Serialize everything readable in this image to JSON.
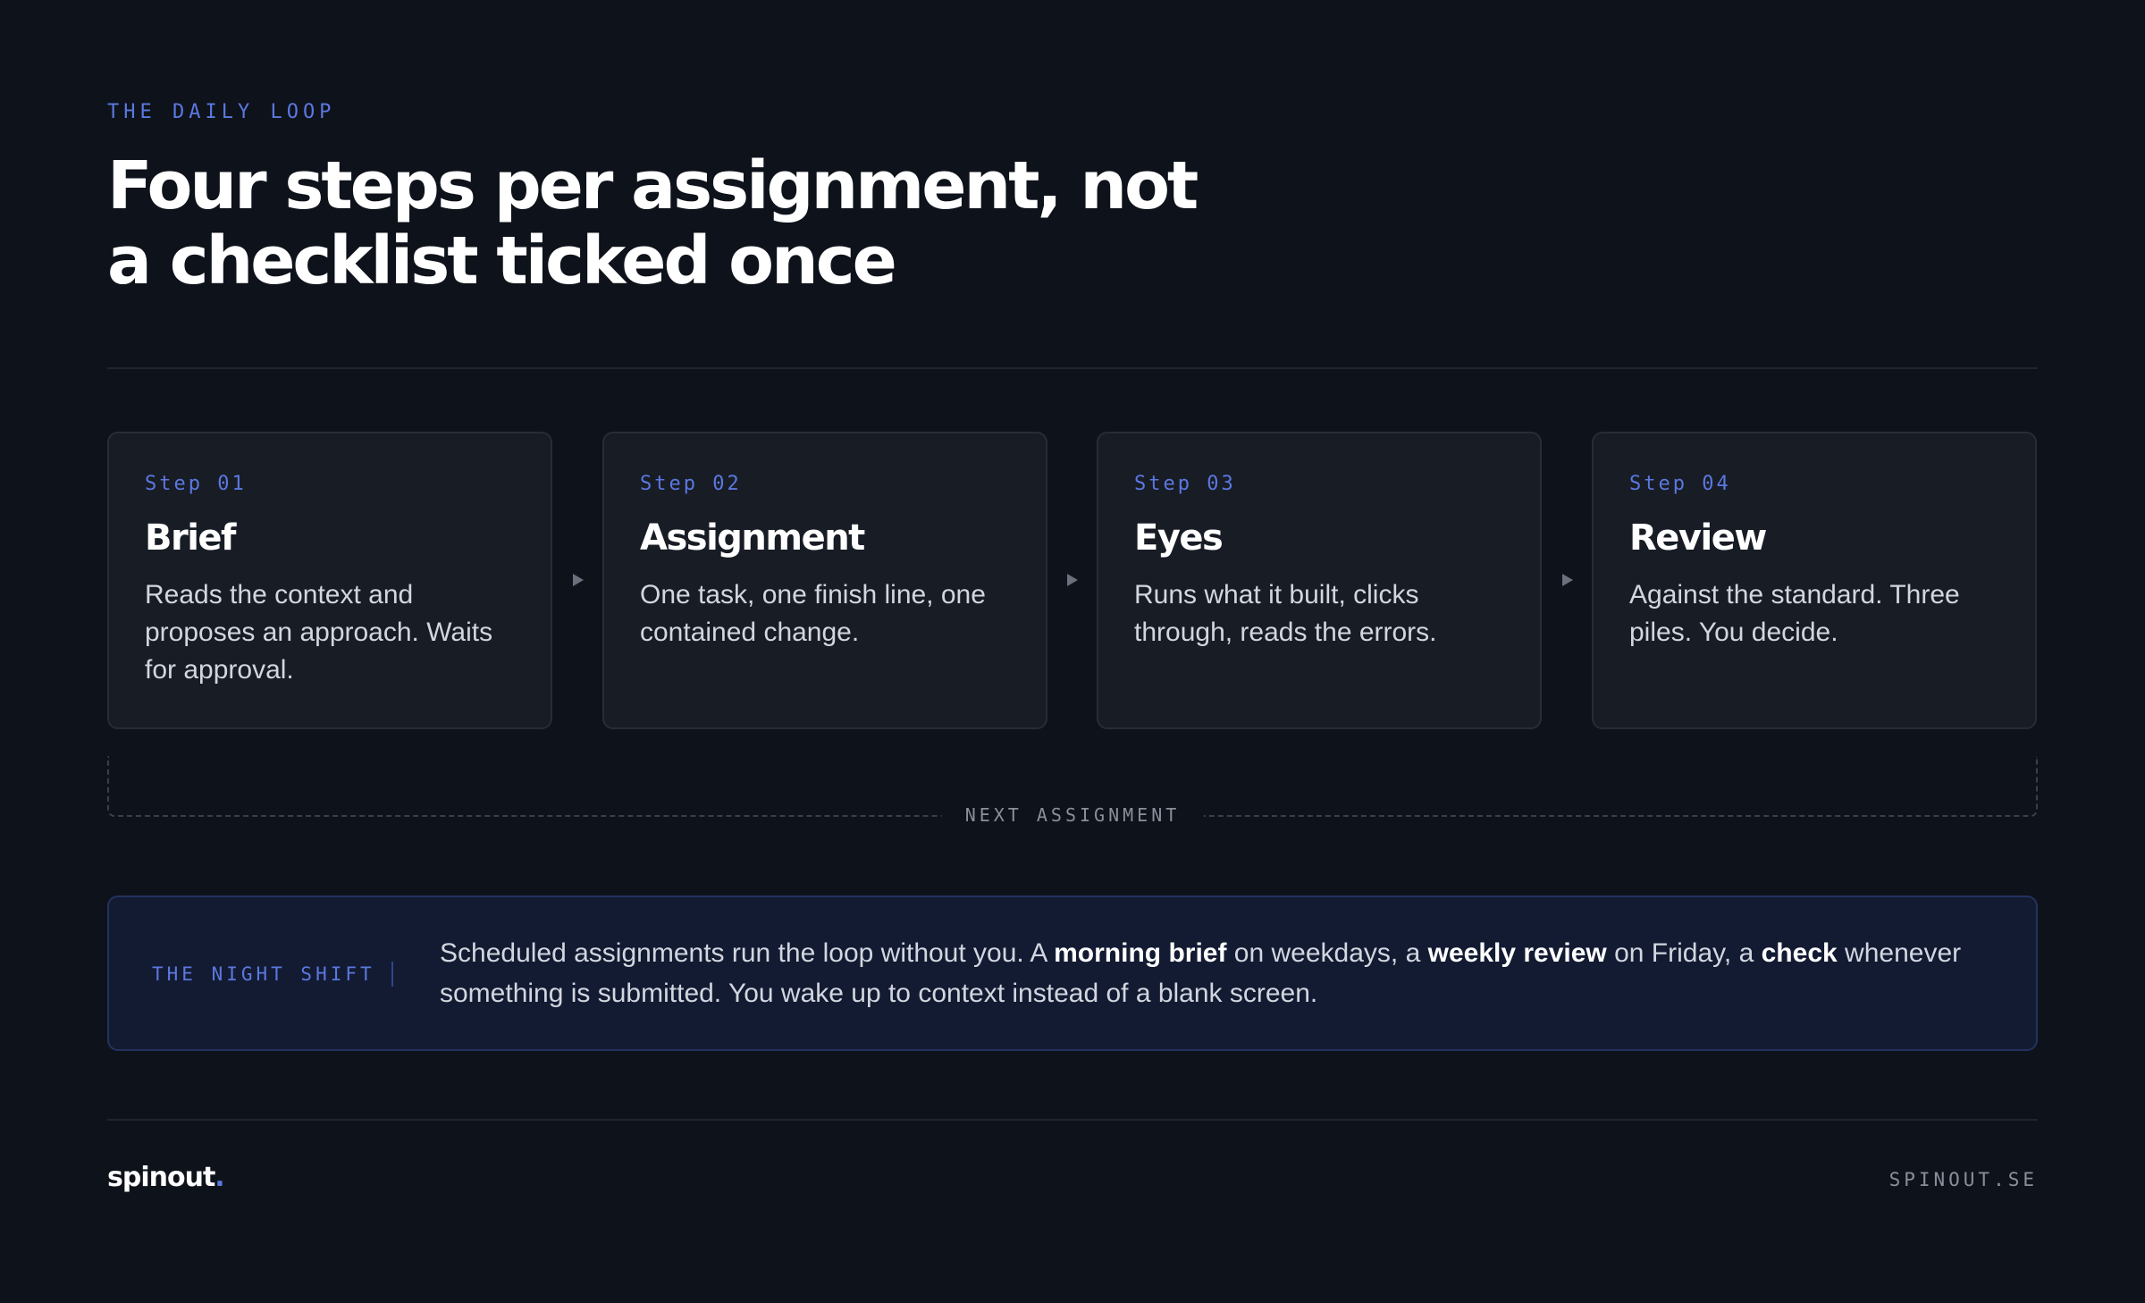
{
  "header": {
    "eyebrow": "THE DAILY LOOP",
    "title_line1": "Four steps per assignment, not",
    "title_line2": "a checklist ticked once"
  },
  "steps": [
    {
      "step": "Step 01",
      "title": "Brief",
      "description": "Reads the context and proposes an approach. Waits for approval."
    },
    {
      "step": "Step 02",
      "title": "Assignment",
      "description": "One task, one finish line, one contained change."
    },
    {
      "step": "Step 03",
      "title": "Eyes",
      "description": "Runs what it built, clicks through, reads the errors."
    },
    {
      "step": "Step 04",
      "title": "Review",
      "description": "Against the standard. Three piles. You decide."
    }
  ],
  "loop": {
    "label": "NEXT ASSIGNMENT"
  },
  "night_shift": {
    "label": "THE NIGHT SHIFT",
    "text_part1": "Scheduled assignments run the loop without you. A ",
    "bold1": "morning brief",
    "text_part2": " on weekdays, a ",
    "bold2": "weekly review",
    "text_part3": " on Friday, a ",
    "bold3": "check",
    "text_part4": " whenever something is submitted. You wake up to context instead of a blank screen."
  },
  "footer": {
    "brand": "spinout",
    "brand_dot": ".",
    "site": "SPINOUT.SE"
  },
  "colors": {
    "background": "#0e121a",
    "card": "#181c25",
    "accent": "#5b78e0",
    "night_panel": "#131b33"
  }
}
